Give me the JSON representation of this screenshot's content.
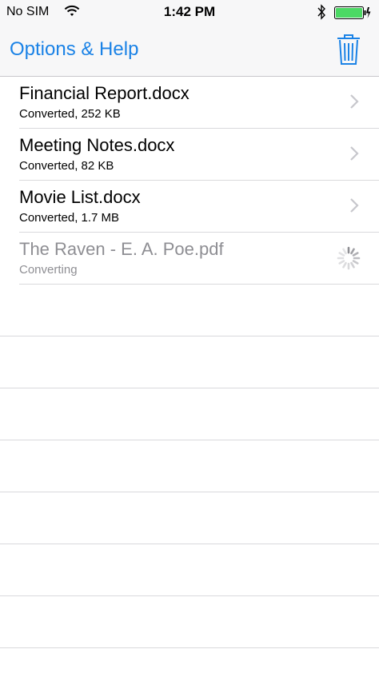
{
  "status_bar": {
    "carrier": "No SIM",
    "time": "1:42 PM",
    "wifi_icon": "wifi-icon",
    "bluetooth_icon": "bluetooth-icon",
    "battery_icon": "battery-icon"
  },
  "nav": {
    "options_label": "Options & Help",
    "trash_icon": "trash-icon",
    "accent_color": "#1a82e6"
  },
  "files": [
    {
      "name": "Financial Report.docx",
      "status": "Converted, 252 KB",
      "state": "converted"
    },
    {
      "name": "Meeting Notes.docx",
      "status": "Converted, 82 KB",
      "state": "converted"
    },
    {
      "name": "Movie List.docx",
      "status": "Converted, 1.7 MB",
      "state": "converted"
    },
    {
      "name": "The Raven - E. A. Poe.pdf",
      "status": "Converting",
      "state": "converting"
    }
  ]
}
